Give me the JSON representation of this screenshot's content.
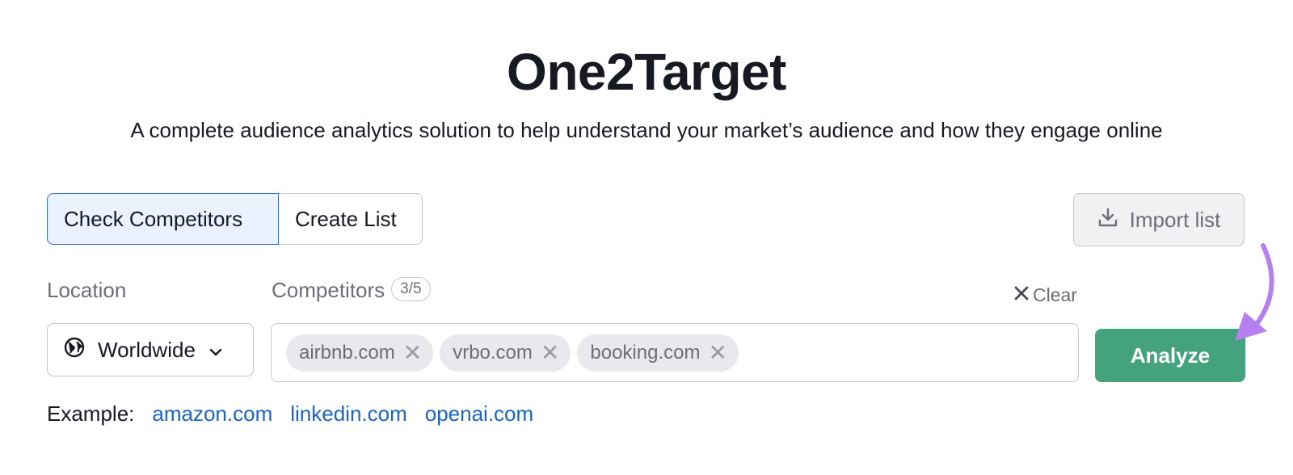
{
  "header": {
    "title": "One2Target",
    "subtitle": "A complete audience analytics solution to help understand your market’s audience and how they engage online"
  },
  "tabs": [
    {
      "label": "Check Competitors",
      "active": true
    },
    {
      "label": "Create List",
      "active": false
    }
  ],
  "import": {
    "label": "Import list",
    "icon": "download-icon"
  },
  "location": {
    "label": "Location",
    "value": "Worldwide",
    "icon": "globe-icon"
  },
  "competitors": {
    "label": "Competitors",
    "count": "3/5",
    "clear_label": "Clear",
    "chips": [
      "airbnb.com",
      "vrbo.com",
      "booking.com"
    ]
  },
  "analyze": {
    "label": "Analyze"
  },
  "examples": {
    "label": "Example:",
    "links": [
      "amazon.com",
      "linkedin.com",
      "openai.com"
    ]
  },
  "colors": {
    "accent": "#45a27f",
    "link": "#1a64c4",
    "active_tab_bg": "#e9f2fe",
    "annotation_arrow": "#b67ff0"
  }
}
